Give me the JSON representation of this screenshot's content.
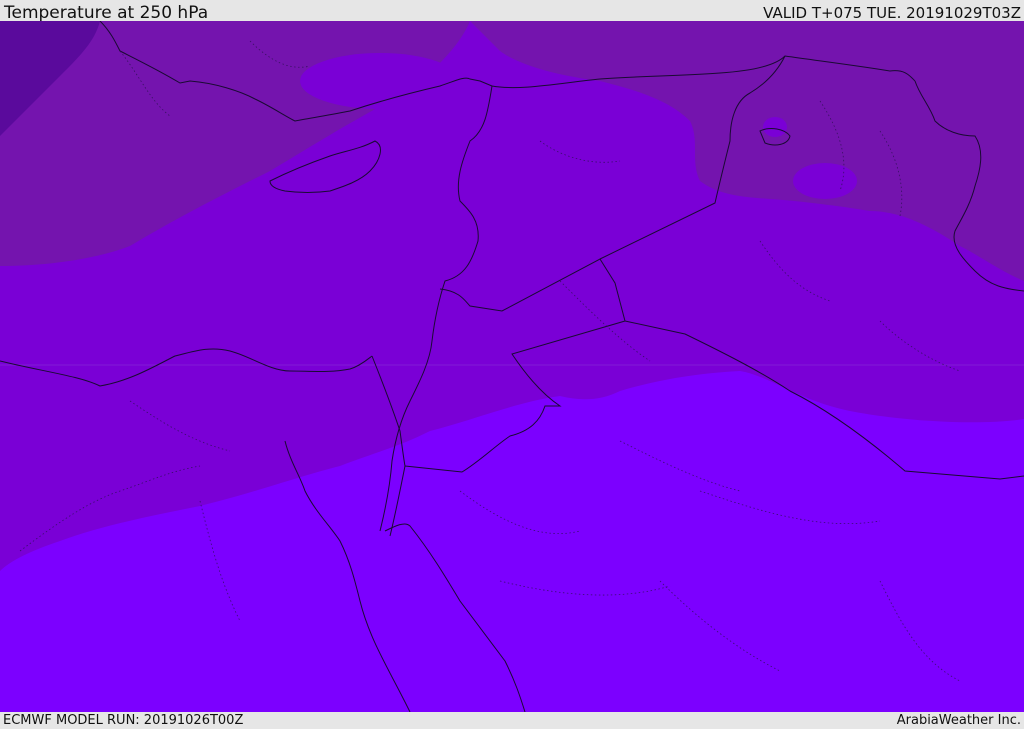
{
  "header": {
    "title": "Temperature at 250 hPa",
    "valid_time": "VALID T+075 TUE. 20191029T03Z"
  },
  "footer": {
    "model_run": "ECMWF MODEL RUN: 20191026T00Z",
    "credit": "ArabiaWeather Inc."
  },
  "map": {
    "field": "Temperature at 250 hPa",
    "colors": {
      "coldest": "#5a0a9c",
      "cold": "#7414ae",
      "mid": "#7a00d6",
      "warm": "#7c00ff",
      "borders": "#1a0a33"
    }
  }
}
